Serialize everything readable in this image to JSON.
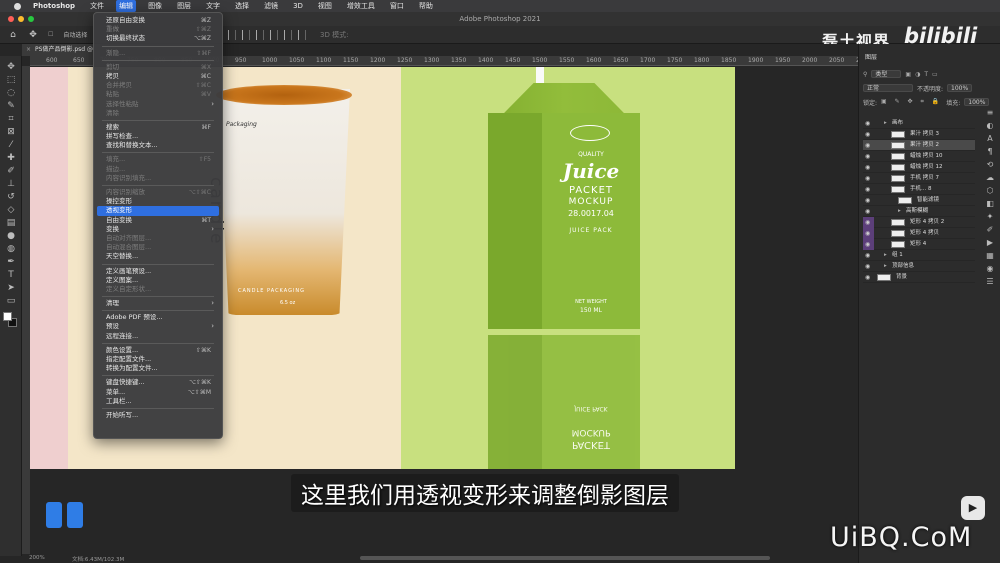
{
  "menubar": {
    "app": "Photoshop",
    "items": [
      "文件",
      "编辑",
      "图像",
      "图层",
      "文字",
      "选择",
      "滤镜",
      "3D",
      "视图",
      "增效工具",
      "窗口",
      "帮助"
    ],
    "active": "编辑"
  },
  "window": {
    "title": "Adobe Photoshop 2021"
  },
  "optbar": {
    "auto_select": "自动选择",
    "three_d_label": "3D 模式:"
  },
  "brand": {
    "channel": "磊土视界",
    "site": "bilibili"
  },
  "doc_tab": {
    "name": "PS做产品倒影.psd @"
  },
  "ruler": {
    "ticks": [
      "600",
      "650",
      "700",
      "750",
      "800",
      "850",
      "900",
      "950",
      "1000",
      "1050",
      "1100",
      "1150",
      "1200",
      "1250",
      "1300",
      "1350",
      "1400",
      "1450",
      "1500",
      "1550",
      "1600",
      "1650",
      "1700",
      "1750",
      "1800",
      "1850",
      "1900",
      "1950",
      "2000",
      "2050",
      "2100"
    ]
  },
  "canvas": {
    "cup_text": "candle",
    "cup_small1": "Packaging",
    "cup_small2": "CANDLE PACKAGING",
    "cup_small3": "6.5 oz",
    "carton": {
      "quality": "QUALITY",
      "juice": "Juice",
      "packet": "PACKET",
      "mockup": "MOCKUP",
      "code": "28.0017.04",
      "juice_pack": "JUICE PACK",
      "net_weight": "NET WEIGHT",
      "ml": "150 ML"
    }
  },
  "menu": {
    "items": [
      {
        "label": "还原自由变换",
        "sc": "⌘Z",
        "state": "normal"
      },
      {
        "label": "重做",
        "sc": "⇧⌘Z",
        "state": "disabled"
      },
      {
        "label": "切换最终状态",
        "sc": "⌥⌘Z",
        "state": "normal"
      },
      {
        "sep": true
      },
      {
        "label": "渐隐...",
        "sc": "⇧⌘F",
        "state": "disabled"
      },
      {
        "sep": true
      },
      {
        "label": "剪切",
        "sc": "⌘X",
        "state": "disabled"
      },
      {
        "label": "拷贝",
        "sc": "⌘C",
        "state": "normal"
      },
      {
        "label": "合并拷贝",
        "sc": "⇧⌘C",
        "state": "disabled"
      },
      {
        "label": "粘贴",
        "sc": "⌘V",
        "state": "disabled"
      },
      {
        "label": "选择性粘贴",
        "sc": "",
        "state": "disabled",
        "arrow": "›"
      },
      {
        "label": "清除",
        "sc": "",
        "state": "disabled"
      },
      {
        "sep": true
      },
      {
        "label": "搜索",
        "sc": "⌘F",
        "state": "normal"
      },
      {
        "label": "拼写检查...",
        "sc": "",
        "state": "normal"
      },
      {
        "label": "查找和替换文本...",
        "sc": "",
        "state": "normal"
      },
      {
        "sep": true
      },
      {
        "label": "填充...",
        "sc": "⇧F5",
        "state": "disabled"
      },
      {
        "label": "描边...",
        "sc": "",
        "state": "disabled"
      },
      {
        "label": "内容识别填充...",
        "sc": "",
        "state": "disabled"
      },
      {
        "sep": true
      },
      {
        "label": "内容识别缩放",
        "sc": "⌥⇧⌘C",
        "state": "disabled"
      },
      {
        "label": "操控变形",
        "sc": "",
        "state": "normal"
      },
      {
        "label": "透视变形",
        "sc": "",
        "state": "highlight"
      },
      {
        "label": "自由变换",
        "sc": "⌘T",
        "state": "normal"
      },
      {
        "label": "变换",
        "sc": "",
        "state": "normal",
        "arrow": "›"
      },
      {
        "label": "自动对齐图层...",
        "sc": "",
        "state": "disabled"
      },
      {
        "label": "自动混合图层...",
        "sc": "",
        "state": "disabled"
      },
      {
        "label": "天空替换...",
        "sc": "",
        "state": "normal"
      },
      {
        "sep": true
      },
      {
        "label": "定义画笔预设...",
        "sc": "",
        "state": "normal"
      },
      {
        "label": "定义图案...",
        "sc": "",
        "state": "normal"
      },
      {
        "label": "定义自定形状...",
        "sc": "",
        "state": "disabled"
      },
      {
        "sep": true
      },
      {
        "label": "清理",
        "sc": "",
        "state": "normal",
        "arrow": "›"
      },
      {
        "sep": true
      },
      {
        "label": "Adobe PDF 预设...",
        "sc": "",
        "state": "normal"
      },
      {
        "label": "预设",
        "sc": "",
        "state": "normal",
        "arrow": "›"
      },
      {
        "label": "远程连接...",
        "sc": "",
        "state": "normal"
      },
      {
        "sep": true
      },
      {
        "label": "颜色设置...",
        "sc": "⇧⌘K",
        "state": "normal"
      },
      {
        "label": "指定配置文件...",
        "sc": "",
        "state": "normal"
      },
      {
        "label": "转换为配置文件...",
        "sc": "",
        "state": "normal"
      },
      {
        "sep": true
      },
      {
        "label": "键盘快捷键...",
        "sc": "⌥⇧⌘K",
        "state": "normal"
      },
      {
        "label": "菜单...",
        "sc": "⌥⇧⌘M",
        "state": "normal"
      },
      {
        "label": "工具栏...",
        "sc": "",
        "state": "normal"
      },
      {
        "sep": true
      },
      {
        "label": "开始听写...",
        "sc": "",
        "state": "normal"
      }
    ]
  },
  "layers_panel": {
    "tab": "图层",
    "filter_kind": "类型",
    "blend_mode": "正常",
    "opacity_label": "不透明度:",
    "opacity": "100%",
    "lock_label": "锁定:",
    "fill_label": "填充:",
    "fill": "100%",
    "layers": [
      {
        "name": "画布",
        "indent": 1,
        "thumb": false,
        "sel": false,
        "purple": false
      },
      {
        "name": "果汁 拷贝 3",
        "indent": 2,
        "thumb": true,
        "sel": false,
        "purple": false
      },
      {
        "name": "果汁 拷贝 2",
        "indent": 2,
        "thumb": true,
        "sel": true,
        "purple": false
      },
      {
        "name": "蜡烛 拷贝 10",
        "indent": 2,
        "thumb": true,
        "sel": false,
        "purple": false
      },
      {
        "name": "蜡烛 拷贝 12",
        "indent": 2,
        "thumb": true,
        "sel": false,
        "purple": false
      },
      {
        "name": "手机 拷贝 7",
        "indent": 2,
        "thumb": true,
        "sel": false,
        "purple": false
      },
      {
        "name": "手机... 8",
        "indent": 2,
        "thumb": true,
        "sel": false,
        "purple": false
      },
      {
        "name": "智能滤镜",
        "indent": 3,
        "thumb": true,
        "sel": false,
        "purple": false
      },
      {
        "name": "高斯模糊",
        "indent": 3,
        "thumb": false,
        "sel": false,
        "purple": false
      },
      {
        "name": "矩形 4 拷贝 2",
        "indent": 2,
        "thumb": true,
        "sel": false,
        "purple": true
      },
      {
        "name": "矩形 4 拷贝",
        "indent": 2,
        "thumb": true,
        "sel": false,
        "purple": true
      },
      {
        "name": "矩形 4",
        "indent": 2,
        "thumb": true,
        "sel": false,
        "purple": true
      },
      {
        "name": "组 1",
        "indent": 1,
        "thumb": false,
        "sel": false,
        "purple": false
      },
      {
        "name": "顶部信息",
        "indent": 1,
        "thumb": false,
        "sel": false,
        "purple": false
      },
      {
        "name": "背景",
        "indent": 0,
        "thumb": true,
        "sel": false,
        "purple": false
      }
    ]
  },
  "status": {
    "zoom": "200%",
    "doc": "文档:6.43M/102.3M"
  },
  "subtitle": "这里我们用透视变形来调整倒影图层",
  "watermark": "UiBQ.CoM",
  "colors": {
    "accent": "#2f6fe0",
    "canvas_pink": "#efcfcf",
    "canvas_cream": "#f4e6c8",
    "canvas_green": "#c8e07f",
    "carton_green": "#8dba3a"
  }
}
